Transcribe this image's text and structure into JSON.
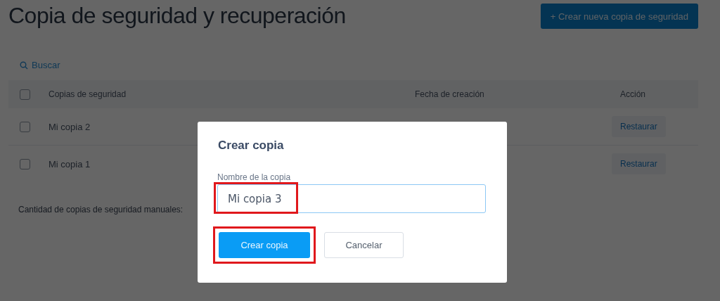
{
  "page": {
    "title": "Copia de seguridad y recuperación",
    "new_button": "+ Crear nueva copia de seguridad",
    "search": "Buscar"
  },
  "table": {
    "columns": [
      "Copias de seguridad",
      "Fecha de creación",
      "Acción"
    ],
    "header_checked": false,
    "rows": [
      {
        "name": "Mi copia 2",
        "checked": false,
        "action": "Restaurar"
      },
      {
        "name": "Mi copia 1",
        "checked": false,
        "action": "Restaurar"
      }
    ]
  },
  "footer": "Cantidad de copias de seguridad manuales:",
  "dialog": {
    "title": "Crear copia",
    "field_label": "Nombre de la copia",
    "field_value": "Mi copia 3",
    "field_highlighted": true,
    "buttons": [
      {
        "label": "Crear copia",
        "kind": "primary",
        "highlighted": true
      },
      {
        "label": "Cancelar",
        "kind": "secondary",
        "highlighted": false
      }
    ]
  }
}
